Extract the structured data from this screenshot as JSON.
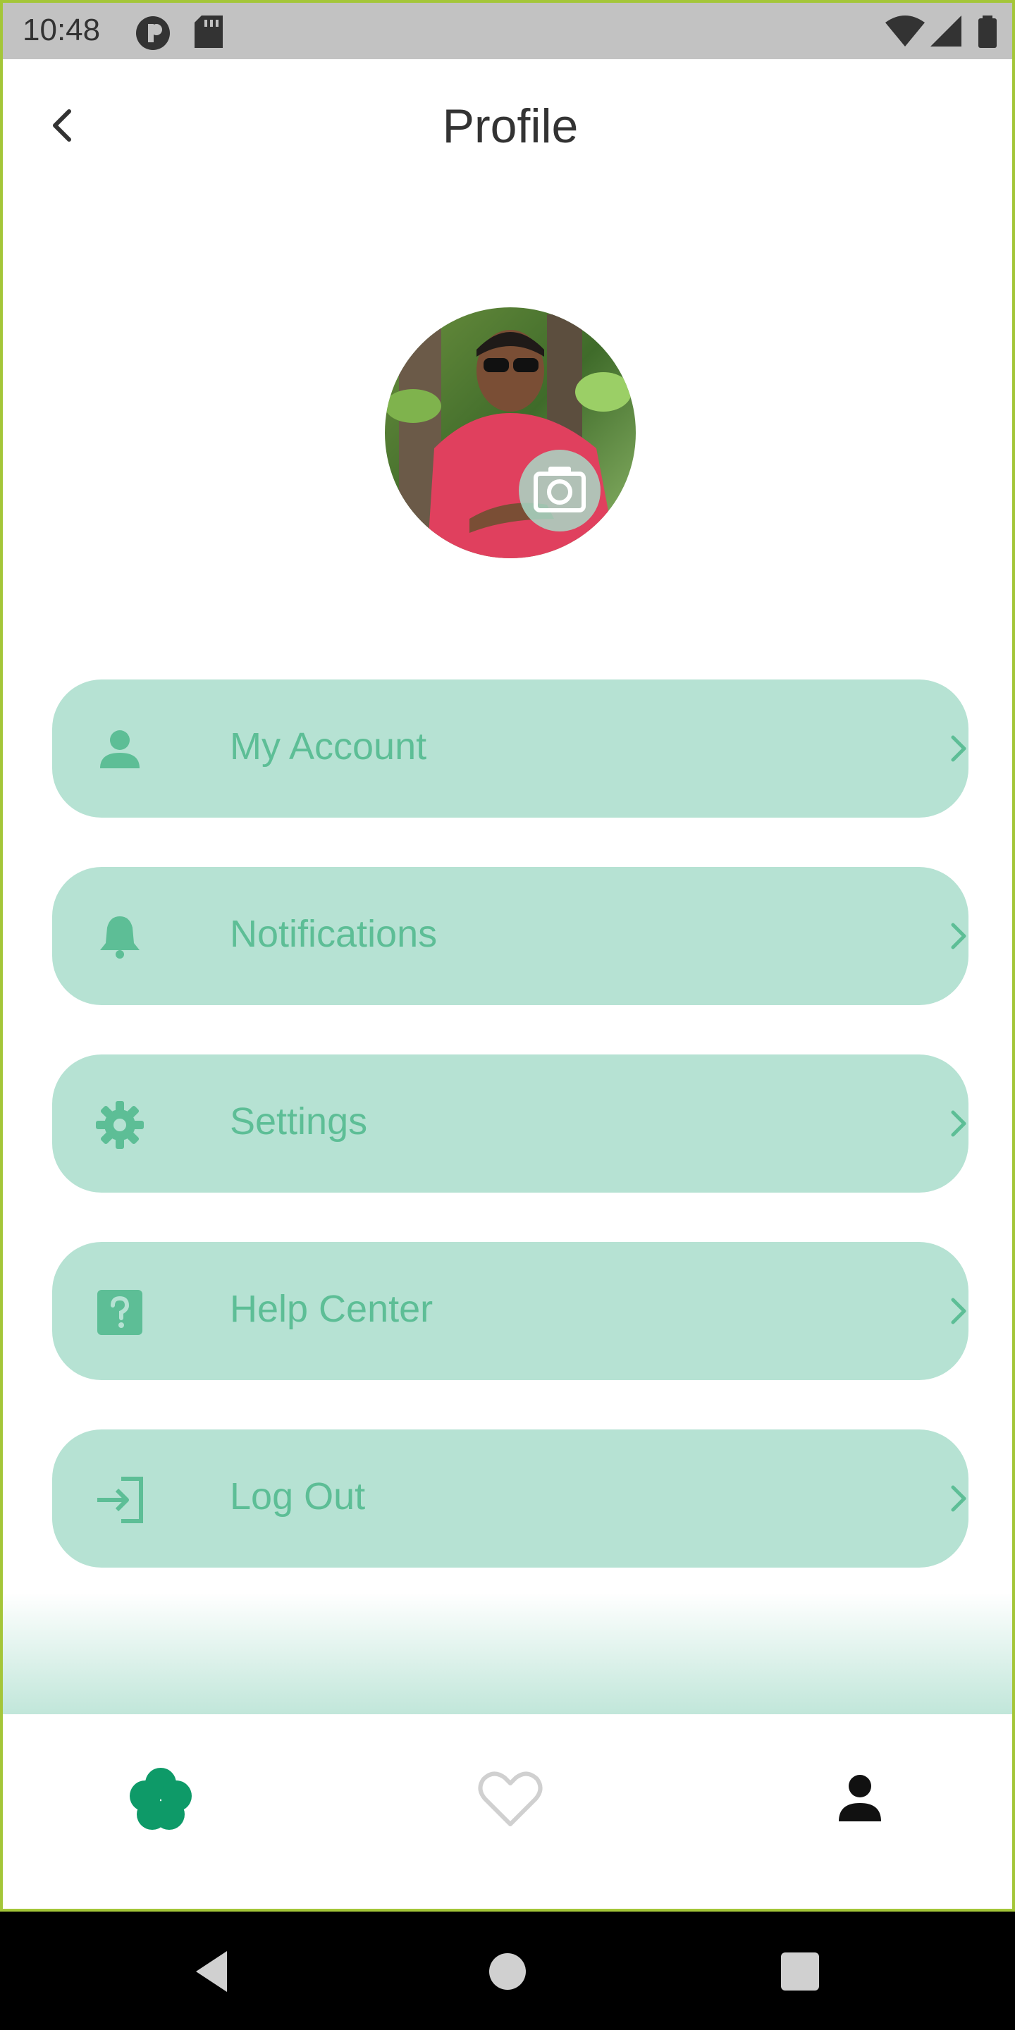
{
  "status_bar": {
    "time": "10:48",
    "icons": [
      "pocket-icon",
      "sd-card-icon",
      "wifi-icon",
      "signal-icon",
      "battery-icon"
    ]
  },
  "header": {
    "title": "Profile",
    "back_icon": "chevron-left-icon"
  },
  "profile": {
    "avatar": "profile-photo",
    "camera_icon": "camera-icon"
  },
  "menu": {
    "items": [
      {
        "label": "My Account",
        "icon": "person-icon"
      },
      {
        "label": "Notifications",
        "icon": "bell-icon"
      },
      {
        "label": "Settings",
        "icon": "gear-icon"
      },
      {
        "label": "Help Center",
        "icon": "help-icon"
      },
      {
        "label": "Log Out",
        "icon": "logout-icon"
      }
    ]
  },
  "bottom_nav": {
    "items": [
      "flower-icon",
      "heart-icon",
      "person-icon"
    ],
    "active": "person-icon"
  },
  "colors": {
    "accent": "#0e9a68",
    "menu_bg": "#b6e2d3",
    "menu_text": "#5dbe96",
    "title": "#333333"
  }
}
